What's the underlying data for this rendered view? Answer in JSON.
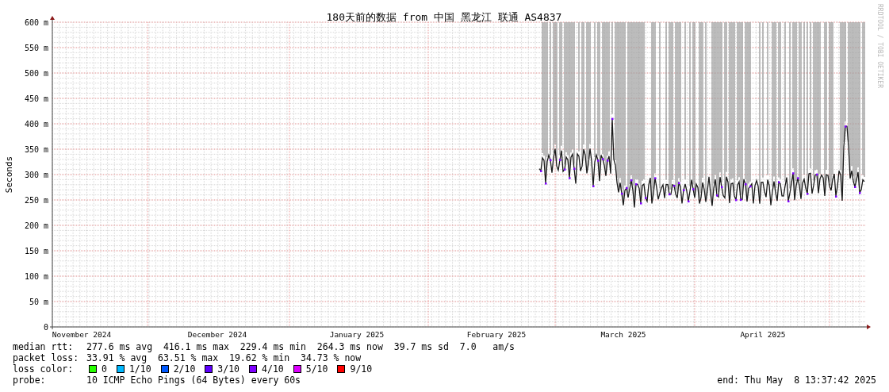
{
  "title": "180天前的数据 from 中国 黑龙江 联通 AS4837",
  "credit": "RRDTOOL / TOBI OETIKER",
  "y_axis": {
    "label": "Seconds",
    "ticks": [
      "600 m",
      "550 m",
      "500 m",
      "450 m",
      "400 m",
      "350 m",
      "300 m",
      "250 m",
      "200 m",
      "150 m",
      "100 m",
      "50 m",
      "0"
    ]
  },
  "x_axis": {
    "ticks": [
      "November 2024",
      "December 2024",
      "January 2025",
      "February 2025",
      "March 2025",
      "April 2025"
    ]
  },
  "legend": {
    "rows": [
      {
        "label": "median rtt:",
        "value": "277.6 ms avg  416.1 ms max  229.4 ms min  264.3 ms now  39.7 ms sd  7.0   am/s"
      },
      {
        "label": "packet loss:",
        "value": "33.91 % avg  63.51 % max  19.62 % min  34.73 % now"
      }
    ],
    "loss_color": {
      "label": "loss color:",
      "items": [
        {
          "label": "0",
          "color": "#26ff00"
        },
        {
          "label": "1/10",
          "color": "#00b8ff"
        },
        {
          "label": "2/10",
          "color": "#0059ff"
        },
        {
          "label": "3/10",
          "color": "#5e00ff"
        },
        {
          "label": "4/10",
          "color": "#7e00ff"
        },
        {
          "label": "5/10",
          "color": "#dd00ff"
        },
        {
          "label": "9/10",
          "color": "#ff0000"
        }
      ]
    },
    "probe": {
      "label": "probe:",
      "value": "10 ICMP Echo Pings (64 Bytes) every 60s"
    },
    "end": "end: Thu May  8 13:37:42 2025"
  }
}
